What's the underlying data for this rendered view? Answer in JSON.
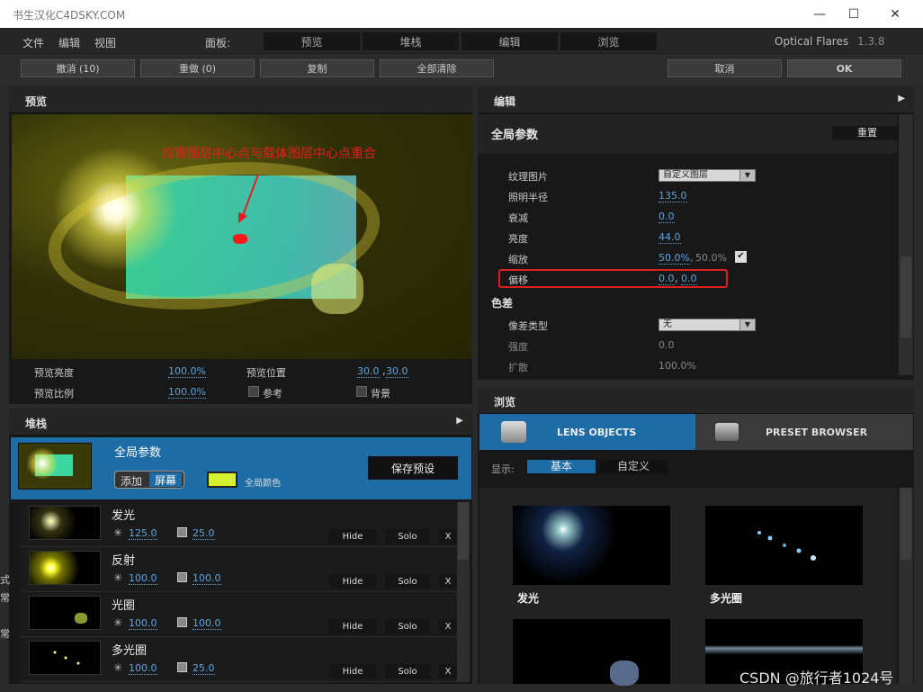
{
  "window": {
    "title": "书生汉化C4DSKY.COM",
    "min": "—",
    "max": "☐",
    "close": "✕"
  },
  "menu": {
    "file": "文件",
    "edit": "编辑",
    "view": "视图",
    "panel_label": "面板:",
    "tabs": [
      "预览",
      "堆栈",
      "编辑",
      "浏览"
    ],
    "app_name": "Optical Flares",
    "version": "1.3.8"
  },
  "toolbar": {
    "undo": "撤消 (10)",
    "redo": "重做 (0)",
    "copy": "复制",
    "clear_all": "全部清除",
    "cancel": "取消",
    "ok": "OK"
  },
  "preview": {
    "header": "预览",
    "annotation": "纹理图层中心点与载体图层中心点重合",
    "brightness_label": "预览亮度",
    "brightness": "100.0%",
    "position_label": "预览位置",
    "position_x": "30.0",
    "position_y": "30.0",
    "scale_label": "预览比例",
    "scale": "100.0%",
    "ref_label": "参考",
    "bg_label": "背景"
  },
  "editor": {
    "header": "编辑",
    "section_title": "全局参数",
    "reset": "重置",
    "rows": [
      {
        "label": "纹理图片",
        "value": "自定义图层",
        "kind": "dropdown"
      },
      {
        "label": "照明半径",
        "value": "135.0"
      },
      {
        "label": "衰减",
        "value": "0.0"
      },
      {
        "label": "亮度",
        "value": "44.0"
      },
      {
        "label": "缩放",
        "value": "50.0%",
        "value2": "50.0%"
      },
      {
        "label": "偏移",
        "value": "0.0",
        "value2": "0.0"
      }
    ],
    "chroma_title": "色差",
    "chroma_rows": [
      {
        "label": "像差类型",
        "value": "无",
        "kind": "dropdown"
      },
      {
        "label": "强度",
        "value": "0.0"
      },
      {
        "label": "扩散",
        "value": "100.0%"
      }
    ]
  },
  "stack": {
    "header": "堆栈",
    "global": {
      "title": "全局参数",
      "add": "添加",
      "screen": "屏幕",
      "color_label": "全局颜色",
      "save": "保存预设",
      "color": "#d4f030"
    },
    "items": [
      {
        "name": "发光",
        "brightness": "125.0",
        "scale": "25.0"
      },
      {
        "name": "反射",
        "brightness": "100.0",
        "scale": "100.0"
      },
      {
        "name": "光圈",
        "brightness": "100.0",
        "scale": "100.0"
      },
      {
        "name": "多光圈",
        "brightness": "100.0",
        "scale": "25.0"
      }
    ],
    "hide": "Hide",
    "solo": "Solo",
    "x": "X"
  },
  "browser": {
    "header": "浏览",
    "tab_lens": "LENS OBJECTS",
    "tab_preset": "PRESET BROWSER",
    "show_label": "显示:",
    "basic": "基本",
    "custom": "自定义",
    "items": [
      "发光",
      "多光圈"
    ]
  },
  "watermark": "CSDN @旅行者1024号",
  "left_edge": [
    "式",
    "常",
    "常"
  ]
}
